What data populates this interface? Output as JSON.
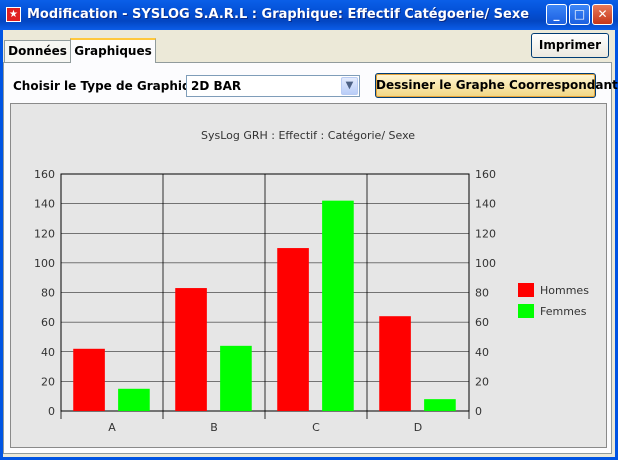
{
  "window": {
    "title": "Modification - SYSLOG S.A.R.L : Graphique: Effectif Catégoerie/ Sexe",
    "app_icon": "star-logo-icon",
    "controls": {
      "minimize": "_",
      "maximize": "□",
      "close": "✕"
    }
  },
  "tabs": [
    {
      "label": "Données",
      "active": false
    },
    {
      "label": "Graphiques",
      "active": true
    }
  ],
  "toolbar": {
    "print_label": "Imprimer",
    "chart_type_label": "Choisir le Type de Graphique :",
    "chart_type_value": "2D BAR",
    "draw_label": "Dessiner le Graphe Coorrespondant"
  },
  "colors": {
    "hommes": "#ff0000",
    "femmes": "#00ff00",
    "title_bar": "#0350d6"
  },
  "chart_data": {
    "type": "bar",
    "title": "SysLog GRH : Effectif : Catégorie/ Sexe",
    "categories": [
      "A",
      "B",
      "C",
      "D"
    ],
    "series": [
      {
        "name": "Hommes",
        "values": [
          42,
          83,
          110,
          64
        ]
      },
      {
        "name": "Femmes",
        "values": [
          15,
          44,
          142,
          8
        ]
      }
    ],
    "ylim": [
      0,
      160
    ],
    "yticks": [
      0,
      20,
      40,
      60,
      80,
      100,
      120,
      140,
      160
    ],
    "grid": true,
    "legend": "right",
    "y_axis_on_both_sides": true
  }
}
